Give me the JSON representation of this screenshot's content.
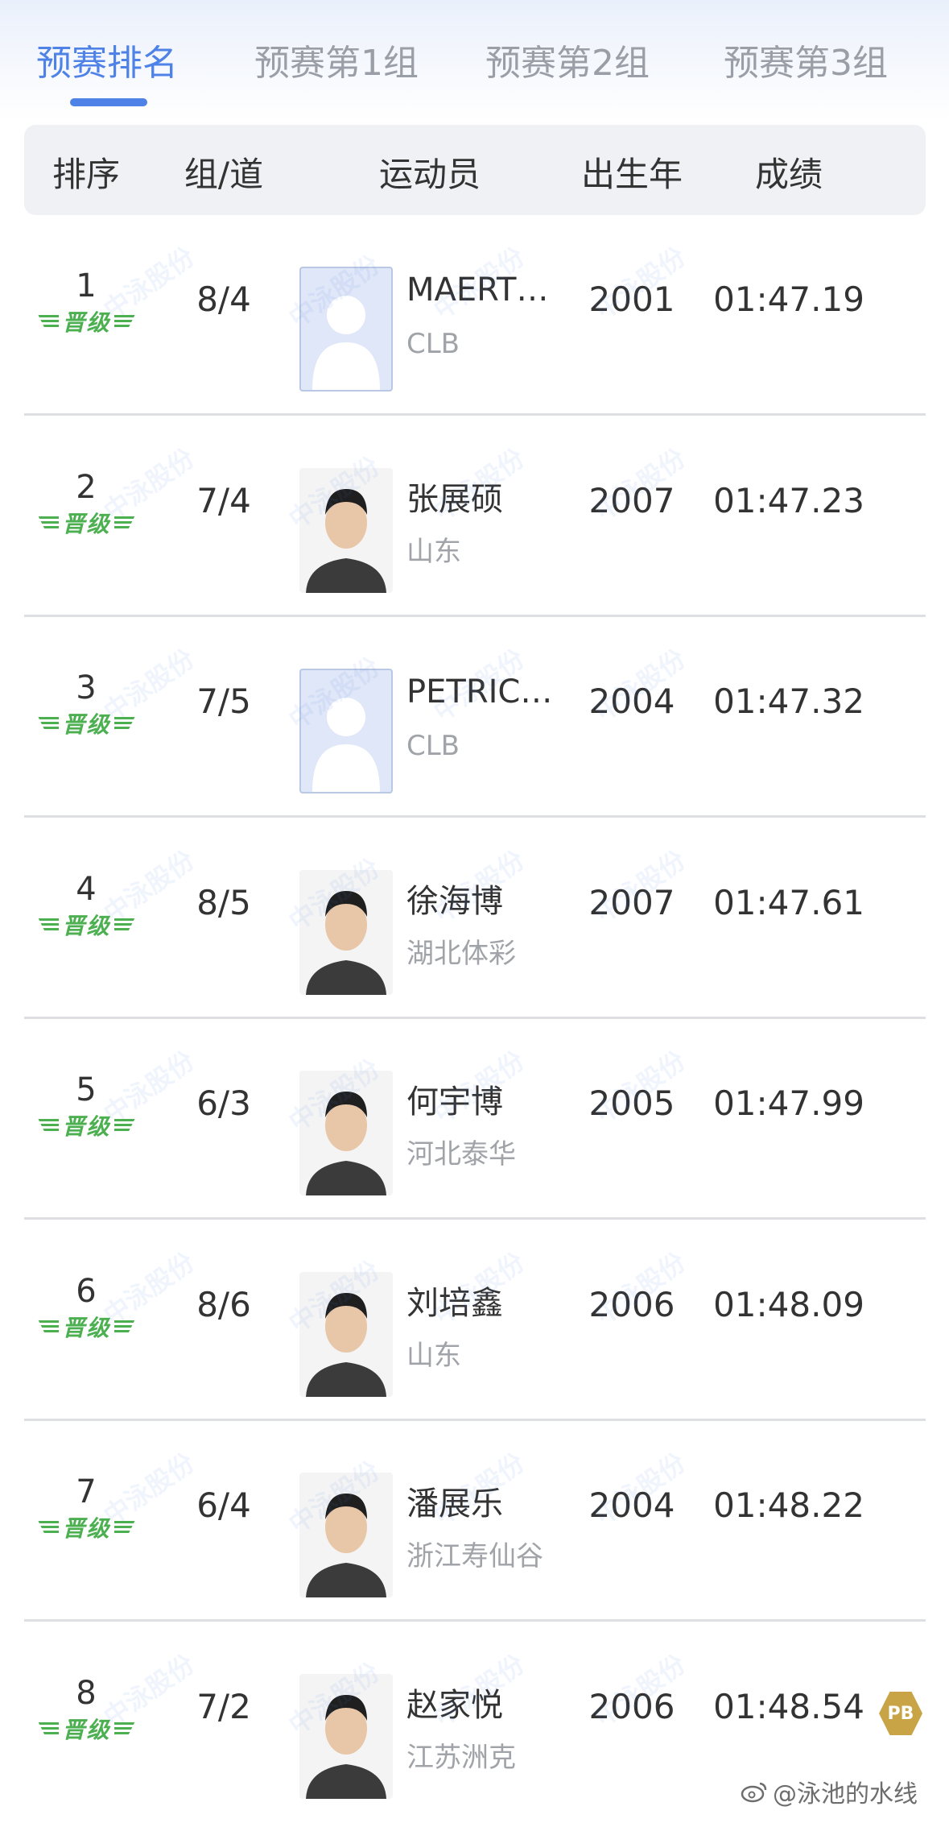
{
  "tabs": [
    {
      "label": "预赛排名",
      "active": true
    },
    {
      "label": "预赛第1组",
      "active": false
    },
    {
      "label": "预赛第2组",
      "active": false
    },
    {
      "label": "预赛第3组",
      "active": false
    }
  ],
  "header": {
    "rank": "排序",
    "lane": "组/道",
    "athlete": "运动员",
    "birth": "出生年",
    "result": "成绩"
  },
  "qualified_label": "晋级",
  "rows": [
    {
      "rank": "1",
      "lane": "8/4",
      "name": "MAERT…",
      "team": "CLB",
      "year": "2001",
      "time": "01:47.19",
      "photo": "placeholder"
    },
    {
      "rank": "2",
      "lane": "7/4",
      "name": "张展硕",
      "team": "山东",
      "year": "2007",
      "time": "01:47.23",
      "photo": "photo"
    },
    {
      "rank": "3",
      "lane": "7/5",
      "name": "PETRIC…",
      "team": "CLB",
      "year": "2004",
      "time": "01:47.32",
      "photo": "placeholder"
    },
    {
      "rank": "4",
      "lane": "8/5",
      "name": "徐海博",
      "team": "湖北体彩",
      "year": "2007",
      "time": "01:47.61",
      "photo": "photo"
    },
    {
      "rank": "5",
      "lane": "6/3",
      "name": "何宇博",
      "team": "河北泰华",
      "year": "2005",
      "time": "01:47.99",
      "photo": "photo"
    },
    {
      "rank": "6",
      "lane": "8/6",
      "name": "刘培鑫",
      "team": "山东",
      "year": "2006",
      "time": "01:48.09",
      "photo": "photo"
    },
    {
      "rank": "7",
      "lane": "6/4",
      "name": "潘展乐",
      "team": "浙江寿仙谷",
      "year": "2004",
      "time": "01:48.22",
      "photo": "photo"
    },
    {
      "rank": "8",
      "lane": "7/2",
      "name": "赵家悦",
      "team": "江苏洲克",
      "year": "2006",
      "time": "01:48.54",
      "photo": "photo"
    }
  ],
  "pb_badge": "PB",
  "watermark": "中泳股份",
  "credit": "@泳池的水线",
  "colors": {
    "accent": "#4f82e6",
    "qualified": "#4caf50",
    "pb": "#c8a446"
  },
  "icons": {
    "weibo": "weibo-icon",
    "pb": "pb-icon",
    "avatar": "avatar-icon"
  }
}
